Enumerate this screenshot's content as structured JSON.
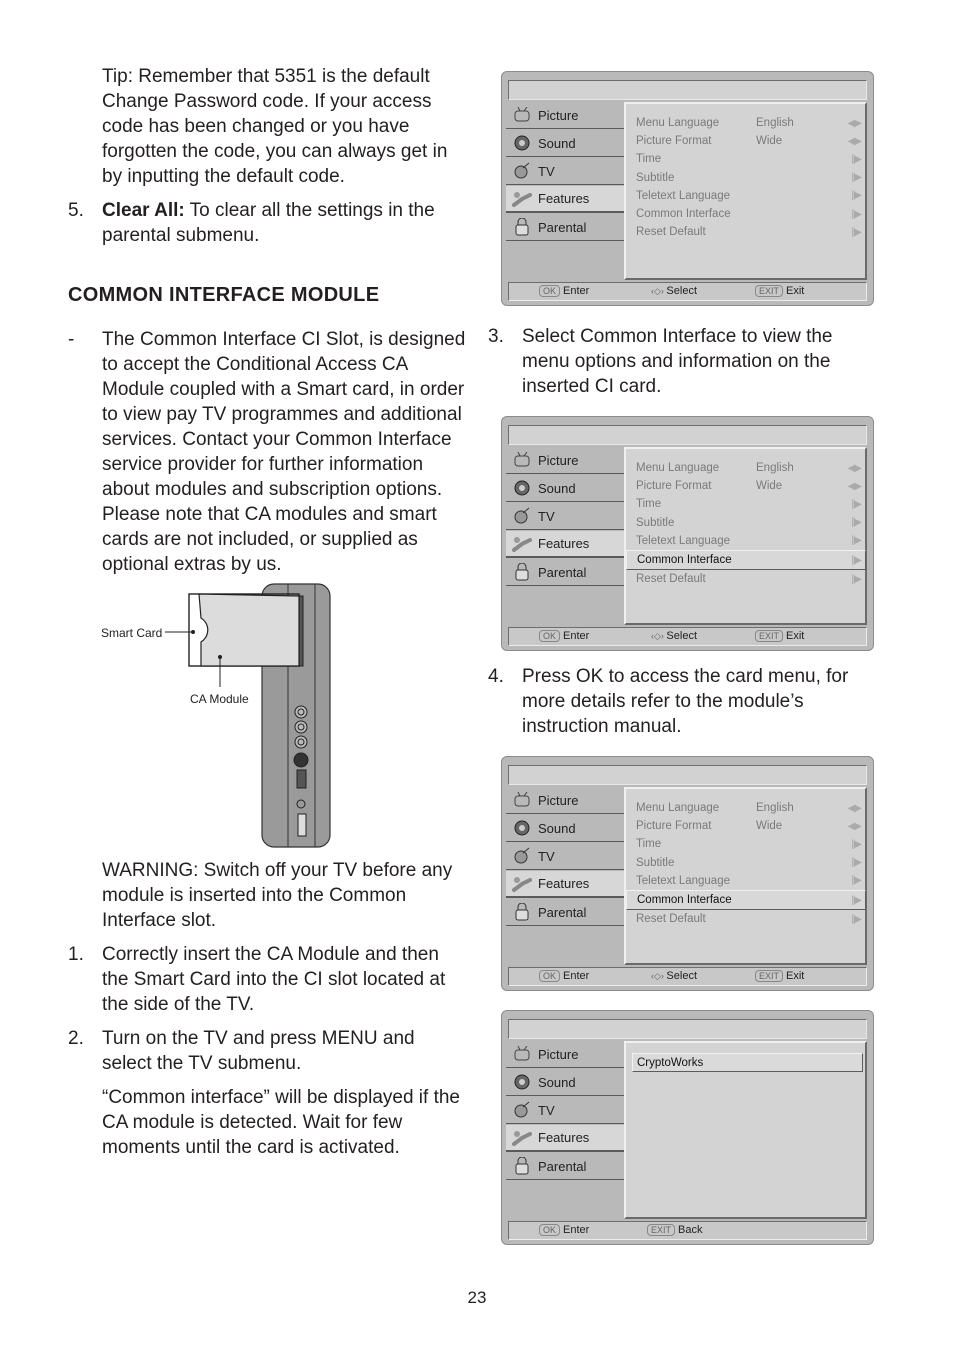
{
  "left": {
    "tip": "Tip: Remember that 5351 is the default Change Password code. If your access code has been changed or you have forgotten the code, you can always get in by inputting the default code.",
    "step5_num": "5.",
    "step5_bold": "Clear All:",
    "step5_text": " To clear all the settings in the parental submenu.",
    "heading": "COMMON INTERFACE MODULE",
    "dash": "-",
    "intro": "The Common Interface CI Slot, is designed to accept the Conditional Access CA Module coupled with a Smart card, in order to view pay TV programmes and additional services. Contact your Common Interface service provider for further information about modules and subscription options. Please note that CA modules and smart cards are not included, or supplied as optional extras by us.",
    "diagram": {
      "smart_card_label": "Smart Card",
      "ca_module_label": "CA Module"
    },
    "warning": "WARNING: Switch off your TV before any module is inserted into the Common Interface slot.",
    "step1_num": "1.",
    "step1": "Correctly insert the CA Module and then the Smart Card into the CI slot located at the side of the TV.",
    "step2_num": "2.",
    "step2": "Turn on the TV and press MENU and select the TV submenu.",
    "step2_note": "“Common interface” will be displayed if the CA module is detected. Wait for few moments until the card is activated."
  },
  "right": {
    "step3_num": "3.",
    "step3": "Select Common Interface to view the menu options and information on the inserted CI card.",
    "step4_num": "4.",
    "step4": "Press OK to access the card menu, for more details refer to the module’s instruction manual."
  },
  "tv_menu": {
    "sidebar": [
      "Picture",
      "Sound",
      "TV",
      "Features",
      "Parental"
    ],
    "active": "Features",
    "rows": [
      {
        "label": "Menu Language",
        "value": "English",
        "arrow": "◀▶"
      },
      {
        "label": "Picture Format",
        "value": "Wide",
        "arrow": "◀▶"
      },
      {
        "label": "Time",
        "value": "",
        "arrow": "||▶"
      },
      {
        "label": "Subtitle",
        "value": "",
        "arrow": "||▶"
      },
      {
        "label": "Teletext Language",
        "value": "",
        "arrow": "||▶"
      },
      {
        "label": "Common Interface",
        "value": "",
        "arrow": "||▶"
      },
      {
        "label": "Reset Default",
        "value": "",
        "arrow": "||▶"
      }
    ],
    "footer": {
      "ok_key": "OK",
      "enter": "Enter",
      "select": "Select",
      "exit_key": "EXIT",
      "exit": "Exit",
      "back": "Back"
    },
    "card_item": "CryptoWorks"
  },
  "page_number": "23"
}
